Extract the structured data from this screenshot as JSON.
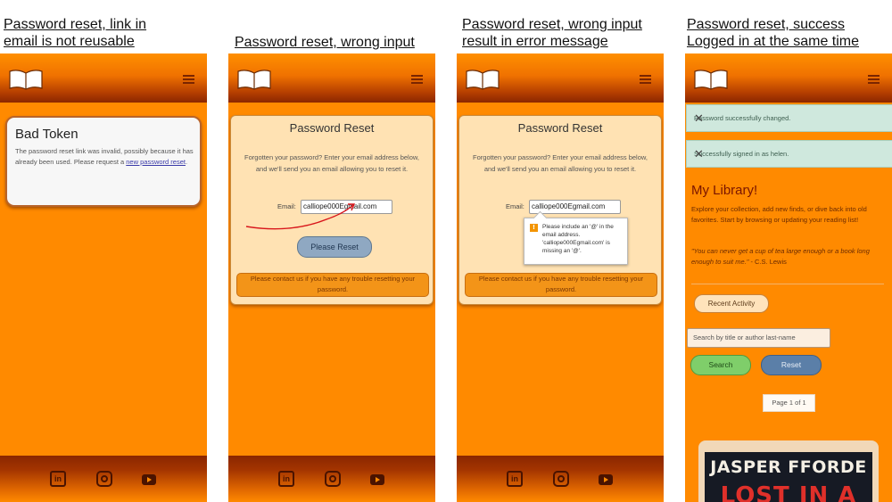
{
  "captions": [
    "Password reset, link in\nemail is not reusable",
    "Password reset, wrong input",
    "Password reset, wrong input\nresult in  error message",
    "Password reset, success\nLogged in at the same time"
  ],
  "colors": {
    "page_bg": "#ff8a00",
    "header_dark": "#8a2600",
    "accent_text": "#7a1500"
  },
  "icons": {
    "logo": "open-book-icon",
    "menu": "hamburger-menu-icon",
    "social": [
      "linkedin-icon",
      "instagram-icon",
      "youtube-icon"
    ]
  },
  "social_linkedin_text": "in",
  "bad_token": {
    "title": "Bad Token",
    "text": "The password reset link was invalid, possibly because it has already been used. Please request a",
    "link": "new password reset",
    "period": "."
  },
  "reset": {
    "title": "Password Reset",
    "description": "Forgotten your password? Enter your email address below, and we'll send you an email allowing you to reset it.",
    "email_label": "Email:",
    "email_value": "calliope000Egmail.com",
    "button": "Please Reset",
    "note": "Please contact us if you have any trouble resetting your password."
  },
  "validation": {
    "icon": "!",
    "message": "Please include an '@' in the email address. 'calliope000Egmail.com' is missing an '@'."
  },
  "success": {
    "alert1": "Password successfully changed.",
    "alert2": "Successfully signed in as helen.",
    "close": "✕",
    "library_title": "My Library!",
    "library_text": "Explore your collection, add new finds, or dive back into old favorites. Start by browsing or updating your reading list!",
    "quote": "\"You can never get a cup of tea large enough or a book long enough to suit me.\"",
    "quote_author": " - C.S. Lewis",
    "recent_button": "Recent Activity",
    "search_placeholder": "Search by title or author last-name",
    "search_button": "Search",
    "reset_button": "Reset",
    "page_indicator": "Page 1 of 1",
    "book_author": "JASPER FFORDE",
    "book_title": "LOST IN A"
  }
}
